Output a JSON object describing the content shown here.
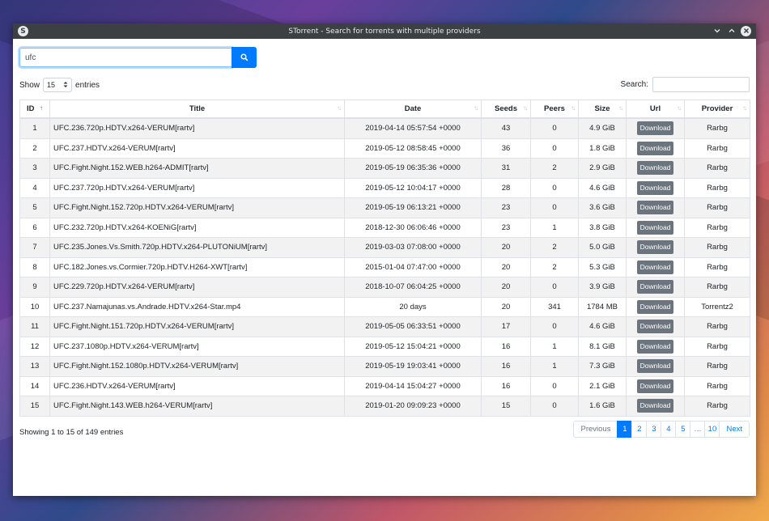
{
  "window": {
    "logo": "S",
    "title": "STorrent - Search for torrents with multiple providers"
  },
  "search": {
    "value": "ufc"
  },
  "length": {
    "prefix": "Show",
    "value": "15",
    "suffix": "entries"
  },
  "filter": {
    "label": "Search:"
  },
  "columns": [
    "ID",
    "Title",
    "Date",
    "Seeds",
    "Peers",
    "Size",
    "Url",
    "Provider"
  ],
  "rows": [
    {
      "id": "1",
      "title": "UFC.236.720p.HDTV.x264-VERUM[rartv]",
      "date": "2019-04-14 05:57:54 +0000",
      "seeds": "43",
      "peers": "0",
      "size": "4.9 GiB",
      "url": "Download",
      "provider": "Rarbg"
    },
    {
      "id": "2",
      "title": "UFC.237.HDTV.x264-VERUM[rartv]",
      "date": "2019-05-12 08:58:45 +0000",
      "seeds": "36",
      "peers": "0",
      "size": "1.8 GiB",
      "url": "Download",
      "provider": "Rarbg"
    },
    {
      "id": "3",
      "title": "UFC.Fight.Night.152.WEB.h264-ADMIT[rartv]",
      "date": "2019-05-19 06:35:36 +0000",
      "seeds": "31",
      "peers": "2",
      "size": "2.9 GiB",
      "url": "Download",
      "provider": "Rarbg"
    },
    {
      "id": "4",
      "title": "UFC.237.720p.HDTV.x264-VERUM[rartv]",
      "date": "2019-05-12 10:04:17 +0000",
      "seeds": "28",
      "peers": "0",
      "size": "4.6 GiB",
      "url": "Download",
      "provider": "Rarbg"
    },
    {
      "id": "5",
      "title": "UFC.Fight.Night.152.720p.HDTV.x264-VERUM[rartv]",
      "date": "2019-05-19 06:13:21 +0000",
      "seeds": "23",
      "peers": "0",
      "size": "3.6 GiB",
      "url": "Download",
      "provider": "Rarbg"
    },
    {
      "id": "6",
      "title": "UFC.232.720p.HDTV.x264-KOENiG[rartv]",
      "date": "2018-12-30 06:06:46 +0000",
      "seeds": "23",
      "peers": "1",
      "size": "3.8 GiB",
      "url": "Download",
      "provider": "Rarbg"
    },
    {
      "id": "7",
      "title": "UFC.235.Jones.Vs.Smith.720p.HDTV.x264-PLUTONiUM[rartv]",
      "date": "2019-03-03 07:08:00 +0000",
      "seeds": "20",
      "peers": "2",
      "size": "5.0 GiB",
      "url": "Download",
      "provider": "Rarbg"
    },
    {
      "id": "8",
      "title": "UFC.182.Jones.vs.Cormier.720p.HDTV.H264-XWT[rartv]",
      "date": "2015-01-04 07:47:00 +0000",
      "seeds": "20",
      "peers": "2",
      "size": "5.3 GiB",
      "url": "Download",
      "provider": "Rarbg"
    },
    {
      "id": "9",
      "title": "UFC.229.720p.HDTV.x264-VERUM[rartv]",
      "date": "2018-10-07 06:04:25 +0000",
      "seeds": "20",
      "peers": "0",
      "size": "3.9 GiB",
      "url": "Download",
      "provider": "Rarbg"
    },
    {
      "id": "10",
      "title": "UFC.237.Namajunas.vs.Andrade.HDTV.x264-Star.mp4",
      "date": "20 days",
      "seeds": "20",
      "peers": "341",
      "size": "1784 MB",
      "url": "Download",
      "provider": "Torrentz2"
    },
    {
      "id": "11",
      "title": "UFC.Fight.Night.151.720p.HDTV.x264-VERUM[rartv]",
      "date": "2019-05-05 06:33:51 +0000",
      "seeds": "17",
      "peers": "0",
      "size": "4.6 GiB",
      "url": "Download",
      "provider": "Rarbg"
    },
    {
      "id": "12",
      "title": "UFC.237.1080p.HDTV.x264-VERUM[rartv]",
      "date": "2019-05-12 15:04:21 +0000",
      "seeds": "16",
      "peers": "1",
      "size": "8.1 GiB",
      "url": "Download",
      "provider": "Rarbg"
    },
    {
      "id": "13",
      "title": "UFC.Fight.Night.152.1080p.HDTV.x264-VERUM[rartv]",
      "date": "2019-05-19 19:03:41 +0000",
      "seeds": "16",
      "peers": "1",
      "size": "7.3 GiB",
      "url": "Download",
      "provider": "Rarbg"
    },
    {
      "id": "14",
      "title": "UFC.236.HDTV.x264-VERUM[rartv]",
      "date": "2019-04-14 15:04:27 +0000",
      "seeds": "16",
      "peers": "0",
      "size": "2.1 GiB",
      "url": "Download",
      "provider": "Rarbg"
    },
    {
      "id": "15",
      "title": "UFC.Fight.Night.143.WEB.h264-VERUM[rartv]",
      "date": "2019-01-20 09:09:23 +0000",
      "seeds": "15",
      "peers": "0",
      "size": "1.6 GiB",
      "url": "Download",
      "provider": "Rarbg"
    }
  ],
  "info": "Showing 1 to 15 of 149 entries",
  "pagination": {
    "previous": "Previous",
    "pages": [
      "1",
      "2",
      "3",
      "4",
      "5",
      "…",
      "10"
    ],
    "active": "1",
    "next": "Next"
  },
  "colors": {
    "accent": "#007bff",
    "titlebar": "#3c4043",
    "button": "#6c757d"
  },
  "icons": {
    "search": "search-icon",
    "sort": "sort-icon",
    "close": "close-icon",
    "minimize": "chevron-down-icon",
    "maximize": "chevron-up-icon"
  }
}
